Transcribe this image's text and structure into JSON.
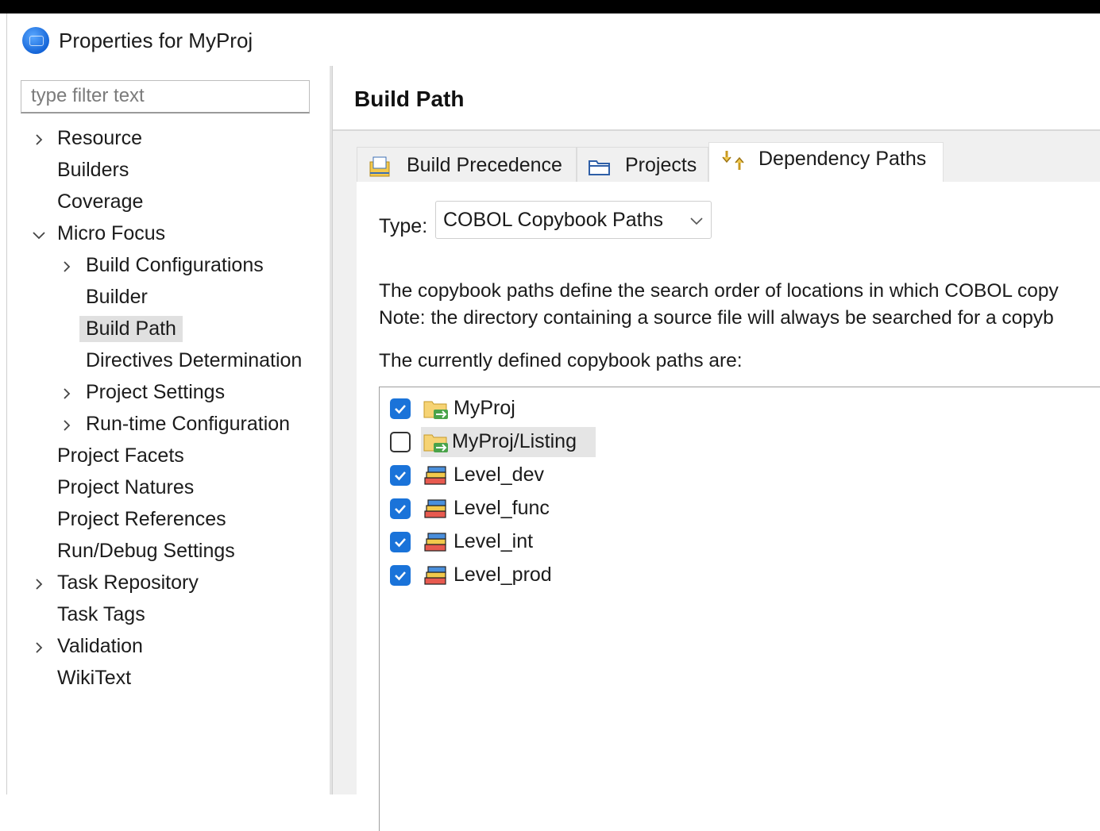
{
  "window": {
    "title": "Properties for MyProj"
  },
  "filter": {
    "placeholder": "type filter text"
  },
  "tree": [
    {
      "label": "Resource",
      "expandable": true,
      "expanded": false
    },
    {
      "label": "Builders"
    },
    {
      "label": "Coverage"
    },
    {
      "label": "Micro Focus",
      "expandable": true,
      "expanded": true
    },
    {
      "label": "Build Configurations",
      "expandable": true,
      "expanded": false
    },
    {
      "label": "Builder"
    },
    {
      "label": "Build Path",
      "selected": true
    },
    {
      "label": "Directives Determination"
    },
    {
      "label": "Project Settings",
      "expandable": true,
      "expanded": false
    },
    {
      "label": "Run-time Configuration",
      "expandable": true,
      "expanded": false
    },
    {
      "label": "Project Facets"
    },
    {
      "label": "Project Natures"
    },
    {
      "label": "Project References"
    },
    {
      "label": "Run/Debug Settings"
    },
    {
      "label": "Task Repository",
      "expandable": true,
      "expanded": false
    },
    {
      "label": "Task Tags"
    },
    {
      "label": "Validation",
      "expandable": true,
      "expanded": false
    },
    {
      "label": "WikiText"
    }
  ],
  "page": {
    "title": "Build Path",
    "tabs": [
      {
        "label": "Build Precedence",
        "icon": "build-precedence-icon"
      },
      {
        "label": "Projects",
        "icon": "projects-folder-icon"
      },
      {
        "label": "Dependency Paths",
        "icon": "dependency-paths-icon",
        "active": true
      }
    ],
    "type_label": "Type:",
    "type_value": "COBOL Copybook Paths",
    "description_line1": "The copybook paths define the search order of locations in which COBOL copy",
    "description_line2": "Note: the directory containing a source file will always be searched for a copyb",
    "list_label": "The currently defined copybook paths are:",
    "paths": [
      {
        "label": "MyProj",
        "checked": true,
        "kind": "folder"
      },
      {
        "label": "MyProj/Listing",
        "checked": false,
        "kind": "folder",
        "highlighted": true
      },
      {
        "label": "Level_dev",
        "checked": true,
        "kind": "library"
      },
      {
        "label": "Level_func",
        "checked": true,
        "kind": "library"
      },
      {
        "label": "Level_int",
        "checked": true,
        "kind": "library"
      },
      {
        "label": "Level_prod",
        "checked": true,
        "kind": "library"
      }
    ]
  },
  "colors": {
    "checkbox_checked": "#1a73d9",
    "selection": "#e0e0e0",
    "panel_bg": "#f0f0f0"
  }
}
